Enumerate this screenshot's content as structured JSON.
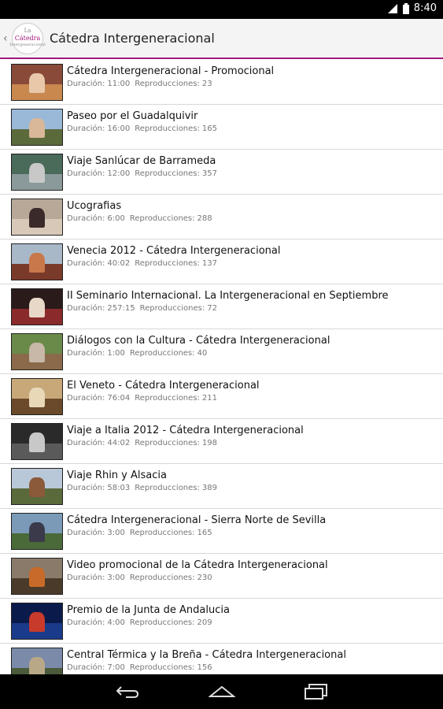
{
  "status_bar": {
    "time": "8:40"
  },
  "header": {
    "logo_lines": [
      "La",
      "Cátedra",
      "Intergeneracional"
    ],
    "title": "Cátedra Intergeneracional"
  },
  "labels": {
    "duration": "Duración:",
    "plays": "Reproducciones:"
  },
  "videos": [
    {
      "title": "Cátedra Intergeneracional - Promocional",
      "duration": "11:00",
      "plays": "23",
      "thumb_colors": [
        "#8a4a3a",
        "#c8884e",
        "#e8c8a8"
      ]
    },
    {
      "title": "Paseo por el Guadalquivir",
      "duration": "16:00",
      "plays": "165",
      "thumb_colors": [
        "#9ab8d8",
        "#5a6a3a",
        "#d8b898"
      ]
    },
    {
      "title": "Viaje Sanlúcar de Barrameda",
      "duration": "12:00",
      "plays": "357",
      "thumb_colors": [
        "#4a6a5a",
        "#8a9a9a",
        "#c8c8c8"
      ]
    },
    {
      "title": "Ucografias",
      "duration": "6:00",
      "plays": "288",
      "thumb_colors": [
        "#b8a898",
        "#d8c8b8",
        "#3a2a2a"
      ]
    },
    {
      "title": "Venecia 2012 - Cátedra Intergeneracional",
      "duration": "40:02",
      "plays": "137",
      "thumb_colors": [
        "#a8b8c8",
        "#7a3a2a",
        "#c8784a"
      ]
    },
    {
      "title": "II Seminario Internacional. La Intergeneracional en Septiembre",
      "duration": "257:15",
      "plays": "72",
      "thumb_colors": [
        "#2a1a1a",
        "#8a2a2a",
        "#e8d8c8"
      ]
    },
    {
      "title": "Diálogos con la Cultura - Cátedra Intergeneracional",
      "duration": "1:00",
      "plays": "40",
      "thumb_colors": [
        "#6a8a4a",
        "#8a6a4a",
        "#c8b8a8"
      ]
    },
    {
      "title": "El Veneto - Cátedra Intergeneracional",
      "duration": "76:04",
      "plays": "211",
      "thumb_colors": [
        "#c8a878",
        "#6a4a2a",
        "#e8d8b8"
      ]
    },
    {
      "title": "Viaje a Italia 2012 - Cátedra Intergeneracional",
      "duration": "44:02",
      "plays": "198",
      "thumb_colors": [
        "#2a2a2a",
        "#5a5a5a",
        "#c8c8c8"
      ]
    },
    {
      "title": "Viaje Rhin y Alsacia",
      "duration": "58:03",
      "plays": "389",
      "thumb_colors": [
        "#b8c8d8",
        "#5a6a3a",
        "#8a5a3a"
      ]
    },
    {
      "title": "Cátedra Intergeneracional - Sierra Norte de Sevilla",
      "duration": "3:00",
      "plays": "165",
      "thumb_colors": [
        "#7a9ab8",
        "#4a6a3a",
        "#3a3a4a"
      ]
    },
    {
      "title": "Video promocional de la Cátedra Intergeneracional",
      "duration": "3:00",
      "plays": "230",
      "thumb_colors": [
        "#8a7a6a",
        "#4a3a2a",
        "#c86a2a"
      ]
    },
    {
      "title": "Premio de la Junta de Andalucia",
      "duration": "4:00",
      "plays": "209",
      "thumb_colors": [
        "#0a1a4a",
        "#1a3a8a",
        "#c83a2a"
      ]
    },
    {
      "title": "Central Térmica y la Breña - Cátedra Intergeneracional",
      "duration": "7:00",
      "plays": "156",
      "thumb_colors": [
        "#7a8aa8",
        "#4a5a3a",
        "#b8a888"
      ]
    }
  ],
  "colors": {
    "accent": "#a0197a",
    "divider": "#d8d8d8",
    "meta_text": "#777777"
  },
  "nav_icons": [
    "back-icon",
    "home-icon",
    "recent-apps-icon"
  ]
}
